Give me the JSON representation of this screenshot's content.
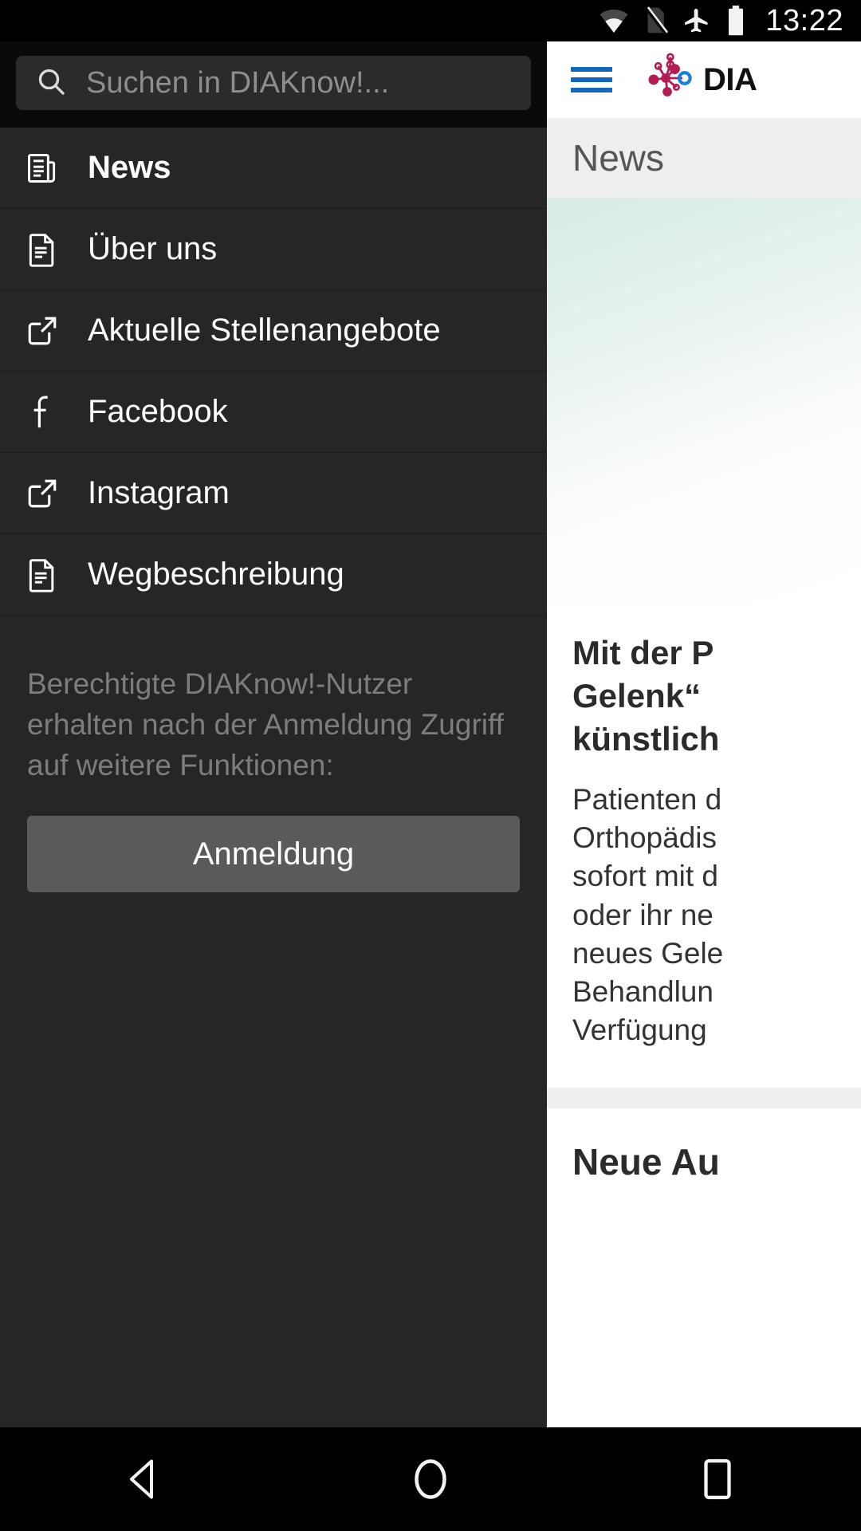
{
  "status_bar": {
    "time": "13:22",
    "icons": [
      "wifi-icon",
      "no-sim-icon",
      "airplane-mode-icon",
      "battery-icon"
    ]
  },
  "drawer": {
    "search": {
      "placeholder": "Suchen in DIAKnow!...",
      "value": "",
      "icon": "search-icon"
    },
    "items": [
      {
        "label": "News",
        "icon": "news-document-icon",
        "active": true
      },
      {
        "label": "Über uns",
        "icon": "document-icon",
        "active": false
      },
      {
        "label": "Aktuelle Stellenangebote",
        "icon": "external-link-icon",
        "active": false
      },
      {
        "label": "Facebook",
        "icon": "facebook-icon",
        "active": false
      },
      {
        "label": "Instagram",
        "icon": "external-link-icon",
        "active": false
      },
      {
        "label": "Wegbeschreibung",
        "icon": "document-icon",
        "active": false
      }
    ],
    "login": {
      "description": "Berechtigte DIAKnow!-Nutzer erhalten nach der Anmeldung Zugriff auf weitere Funktionen:",
      "button_label": "Anmeldung"
    }
  },
  "app": {
    "menu_icon": "hamburger-menu-icon",
    "logo_icon": "diaknow-molecule-logo-icon",
    "brand_text": "DIA",
    "section_title": "News",
    "articles": [
      {
        "title_lines": [
          "Mit der P",
          "Gelenk“",
          "künstlich"
        ],
        "body_lines": [
          "Patienten d",
          "Orthopädis",
          "sofort mit d",
          "oder ihr ne",
          "neues Gele",
          "Behandlun",
          "Verfügung"
        ]
      },
      {
        "title_lines": [
          "Neue Au"
        ],
        "body_lines": []
      }
    ]
  },
  "nav_bar": {
    "buttons": [
      {
        "name": "back-button",
        "icon": "triangle-back-icon"
      },
      {
        "name": "home-button",
        "icon": "circle-home-icon"
      },
      {
        "name": "recents-button",
        "icon": "square-recents-icon"
      }
    ]
  },
  "colors": {
    "drawer_bg": "#262626",
    "accent_blue": "#1565b8",
    "logo_crimson": "#b01e56",
    "login_button": "#5a5a5a"
  }
}
